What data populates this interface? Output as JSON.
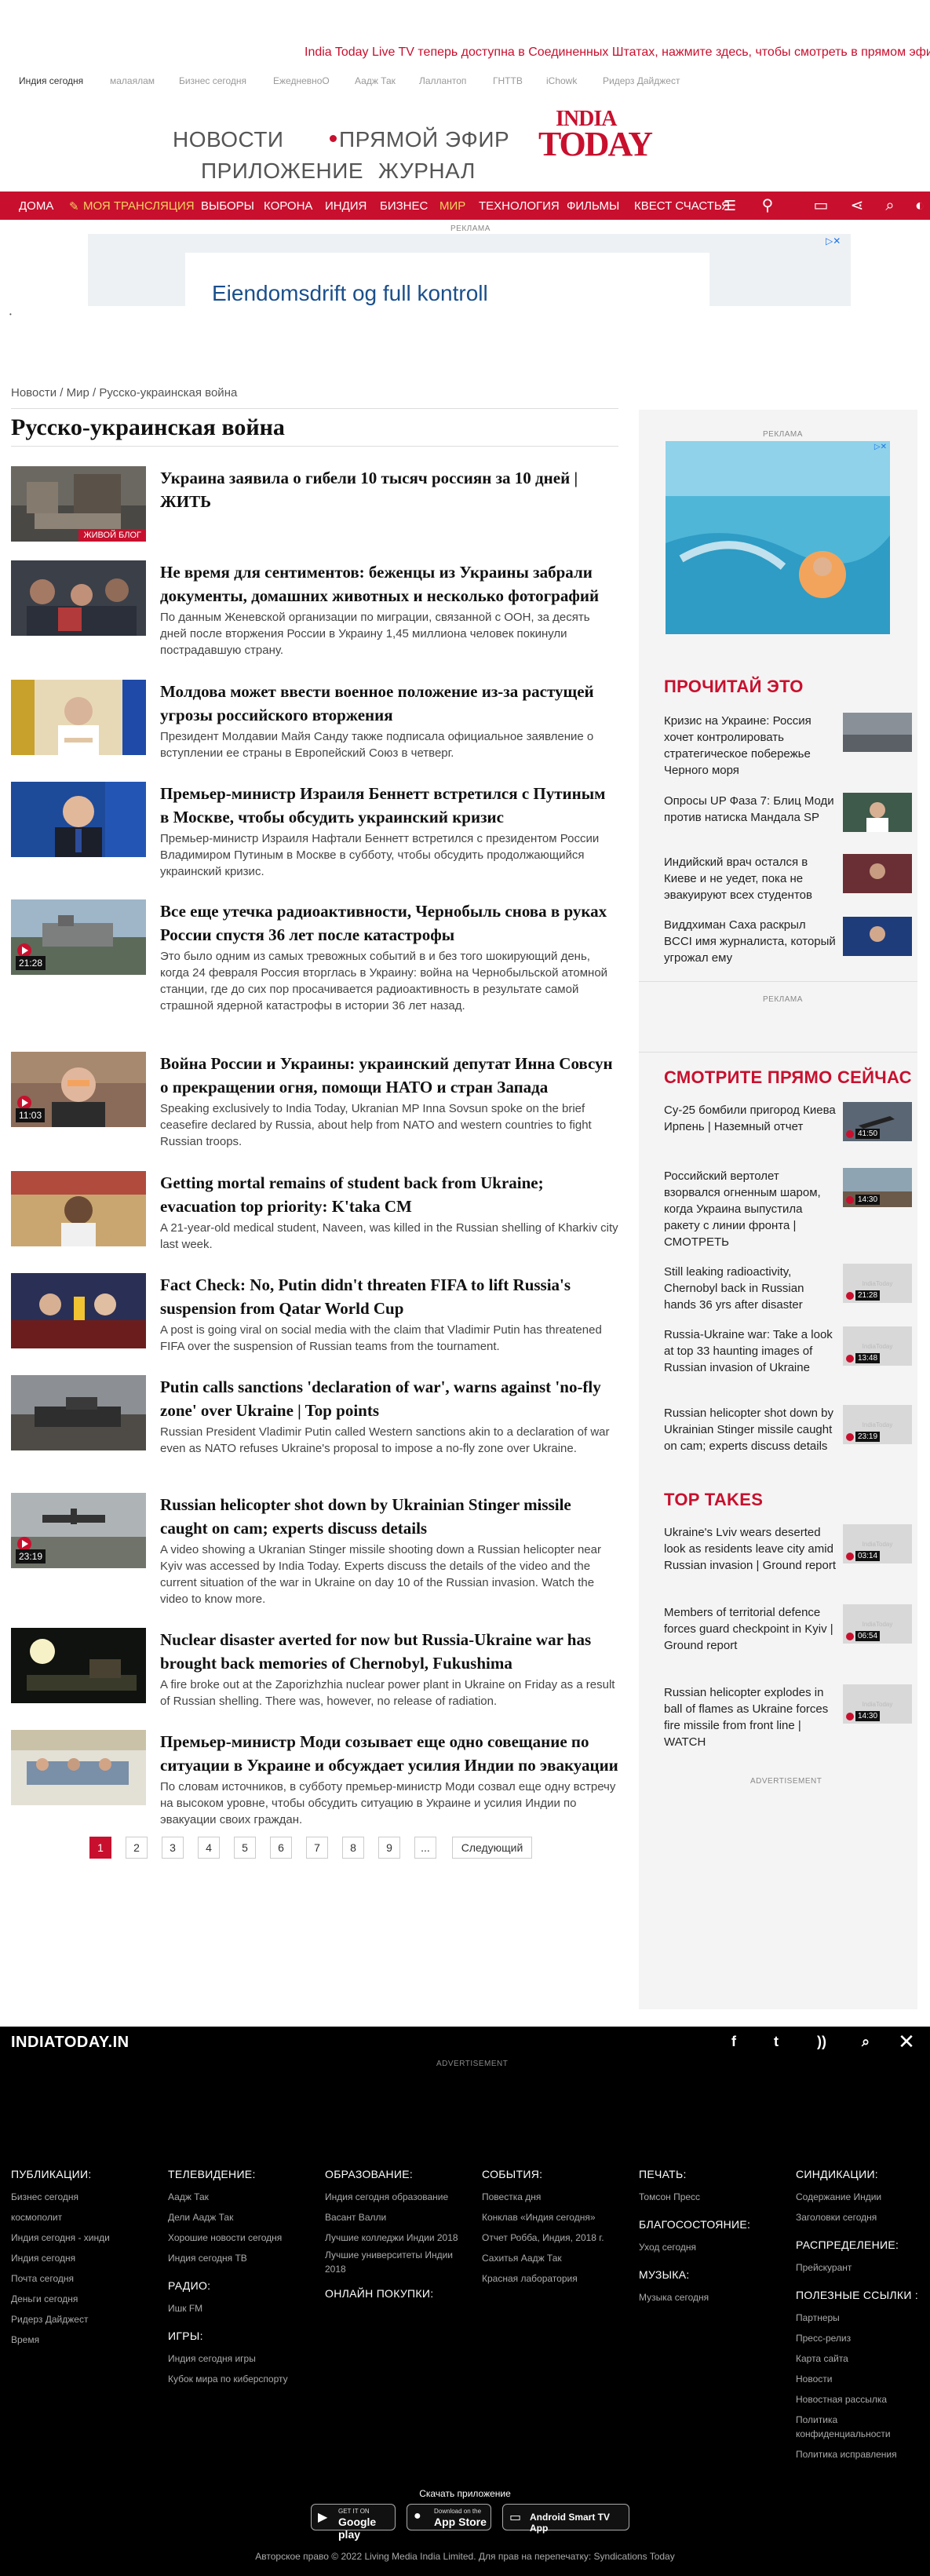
{
  "ticker": "India Today Live TV теперь доступна в Соединенных Штатах, нажмите здесь, чтобы смотреть в прямом эфире",
  "sister_sites": [
    "Индия сегодня",
    "малаялам",
    "Бизнес сегодня",
    "ЕжедневноО",
    "Аадж Так",
    "Лаллантоп",
    "ГНТТВ",
    "iChowk",
    "Ридерз Дайджест"
  ],
  "brand_links": {
    "news": "НОВОСТИ",
    "live": "ПРЯМОЙ ЭФИР",
    "app": "ПРИЛОЖЕНИЕ",
    "magazine": "ЖУРНАЛ"
  },
  "logo": {
    "line1": "INDIA",
    "line2": "TODAY"
  },
  "nav": [
    "ДОМА",
    "МОЯ ТРАНСЛЯЦИЯ",
    "ВЫБОРЫ",
    "КОРОНА",
    "ИНДИЯ",
    "БИЗНЕС",
    "МИР",
    "ТЕХНОЛОГИЯ",
    "ФИЛЬМЫ",
    "КВЕСТ СЧАСТЬЯ"
  ],
  "colors": {
    "brand_red": "#c8102e",
    "footer_bg": "#000000",
    "rail_bg": "#f4f4f4"
  },
  "ad": {
    "label": "РЕКЛАМА",
    "text": "Eiendomsdrift og full kontroll"
  },
  "breadcrumb": {
    "home": "Новости",
    "sep": "/",
    "section": "Мир",
    "current": "Русско-украинская война"
  },
  "page_title": "Русско-украинская война",
  "stories": [
    {
      "title": "Украина заявила о гибели 10 тысяч россиян за 10 дней | ЖИТЬ",
      "desc": "",
      "badge": "ЖИВОЙ БЛОГ",
      "duration": ""
    },
    {
      "title": "Не время для сентиментов: беженцы из Украины забрали документы, домашних животных и несколько фотографий",
      "desc": "По данным Женевской организации по миграции, связанной с ООН, за десять дней после вторжения России в Украину 1,45 миллиона человек покинули пострадавшую страну.",
      "badge": "",
      "duration": ""
    },
    {
      "title": "Молдова может ввести военное положение из-за растущей угрозы российского вторжения",
      "desc": "Президент Молдавии Майя Санду также подписала официальное заявление о вступлении ее страны в Европейский Союз в четверг.",
      "badge": "",
      "duration": ""
    },
    {
      "title": "Премьер-министр Израиля Беннетт встретился с Путиным в Москве, чтобы обсудить украинский кризис",
      "desc": "Премьер-министр Израиля Нафтали Беннетт встретился с президентом России Владимиром Путиным в Москве в субботу, чтобы обсудить продолжающийся украинский кризис.",
      "badge": "",
      "duration": ""
    },
    {
      "title": "Все еще утечка радиоактивности, Чернобыль снова в руках России спустя 36 лет после катастрофы",
      "desc": "Это было одним из самых тревожных событий в и без того шокирующий день, когда 24 февраля Россия вторглась в Украину: война на Чернобыльской атомной станции, где до сих пор просачивается радиоактивность в результате самой страшной ядерной катастрофы в истории 36 лет назад.",
      "badge": "",
      "duration": "21:28"
    },
    {
      "title": "Война России и Украины: украинский депутат Инна Совсун о прекращении огня, помощи НАТО и стран Запада",
      "desc": "Speaking exclusively to India Today, Ukranian MP Inna Sovsun spoke on the brief ceasefire declared by Russia, about help from NATO and western countries to fight Russian troops.",
      "badge": "",
      "duration": "11:03"
    },
    {
      "title": "Getting mortal remains of student back from Ukraine; evacuation top priority: K'taka CM",
      "desc": "A 21-year-old medical student, Naveen, was killed in the Russian shelling of Kharkiv city last week.",
      "badge": "",
      "duration": ""
    },
    {
      "title": "Fact Check: No, Putin didn't threaten FIFA to lift Russia's suspension from Qatar World Cup",
      "desc": "A post is going viral on social media with the claim that Vladimir Putin has threatened FIFA over the suspension of Russian teams from the tournament.",
      "badge": "",
      "duration": ""
    },
    {
      "title": "Putin calls sanctions 'declaration of war', warns against 'no-fly zone' over Ukraine | Top points",
      "desc": "Russian President Vladimir Putin called Western sanctions akin to a declaration of war even as NATO refuses Ukraine's proposal to impose a no-fly zone over Ukraine.",
      "badge": "",
      "duration": ""
    },
    {
      "title": "Russian helicopter shot down by Ukrainian Stinger missile caught on cam; experts discuss details",
      "desc": "A video showing a Ukranian Stinger missile shooting down a Russian helicopter near Kyiv was accessed by India Today. Experts discuss the details of the video and the current situation of the war in Ukraine on day 10 of the Russian invasion. Watch the video to know more.",
      "badge": "",
      "duration": "23:19"
    },
    {
      "title": "Nuclear disaster averted for now but Russia-Ukraine war has brought back memories of Chernobyl, Fukushima",
      "desc": "A fire broke out at the Zaporizhzhia nuclear power plant in Ukraine on Friday as a result of Russian shelling. There was, however, no release of radiation.",
      "badge": "",
      "duration": ""
    },
    {
      "title": "Премьер-министр Моди созывает еще одно совещание по ситуации в Украине и обсуждает усилия Индии по эвакуации",
      "desc": "По словам источников, в субботу премьер-министр Моди созвал еще одну встречу на высоком уровне, чтобы обсудить ситуацию в Украине и усилия Индии по эвакуации своих граждан.",
      "badge": "",
      "duration": ""
    }
  ],
  "pagination": {
    "pages": [
      "1",
      "2",
      "3",
      "4",
      "5",
      "6",
      "7",
      "8",
      "9",
      "..."
    ],
    "next": "Следующий",
    "current": "1"
  },
  "sidebar": {
    "ad_label": "РЕКЛАМА",
    "read_title": "ПРОЧИТАЙ ЭТО",
    "read_items": [
      {
        "text": "Кризис на Украине: Россия хочет контролировать стратегическое побережье Черного моря"
      },
      {
        "text": "Опросы UP Фаза 7: Блиц Моди против натиска Мандала SP"
      },
      {
        "text": "Индийский врач остался в Киеве и не уедет, пока не эвакуируют всех студентов"
      },
      {
        "text": "Виддхиман Саха раскрыл BCCI имя журналиста, который угрожал ему"
      }
    ],
    "ad_label2": "РЕКЛАМА",
    "watch_title": "СМОТРИТЕ ПРЯМО СЕЙЧАС",
    "watch_items": [
      {
        "text": "Су-25 бомбили пригород Киева Ирпень | Наземный отчет",
        "duration": "41:50"
      },
      {
        "text": "Российский вертолет взорвался огненным шаром, когда Украина выпустила ракету с линии фронта | СМОТРЕТЬ",
        "duration": "14:30"
      },
      {
        "text": "Still leaking radioactivity, Chernobyl back in Russian hands 36 yrs after disaster",
        "duration": "21:28"
      },
      {
        "text": "Russia-Ukraine war: Take a look at top 33 haunting images of Russian invasion of Ukraine",
        "duration": "13:48"
      },
      {
        "text": "Russian helicopter shot down by Ukrainian Stinger missile caught on cam; experts discuss details",
        "duration": "23:19"
      }
    ],
    "top_title": "TOP TAKES",
    "top_items": [
      {
        "text": "Ukraine's Lviv wears deserted look as residents leave city amid Russian invasion | Ground report",
        "duration": "03:14"
      },
      {
        "text": "Members of territorial defence forces guard checkpoint in Kyiv | Ground report",
        "duration": "06:54"
      },
      {
        "text": "Russian helicopter explodes in ball of flames as Ukraine forces fire missile from front line | WATCH",
        "duration": "14:30"
      }
    ],
    "ad_label3": "ADVERTISEMENT"
  },
  "footer": {
    "logo": "INDIATODAY.IN",
    "ad_label": "ADVERTISEMENT",
    "columns": [
      {
        "heading": "ПУБЛИКАЦИИ:",
        "links": [
          "Бизнес сегодня",
          "космополит",
          "Индия сегодня - хинди",
          "Индия сегодня",
          "Почта сегодня",
          "Деньги сегодня",
          "Ридерз Дайджест",
          "Время"
        ]
      },
      {
        "heading": "ТЕЛЕВИДЕНИЕ:",
        "links": [
          "Аадж Так",
          "Дели Аадж Так",
          "Хорошие новости сегодня",
          "Индия сегодня ТВ"
        ],
        "heading2": "РАДИО:",
        "links2": [
          "Ишк FM"
        ],
        "heading3": "ИГРЫ:",
        "links3": [
          "Индия сегодня игры",
          "Кубок мира по киберспорту"
        ]
      },
      {
        "heading": "ОБРАЗОВАНИЕ:",
        "links": [
          "Индия сегодня образование",
          "Васант Валли",
          "Лучшие колледжи Индии 2018",
          "Лучшие университеты Индии 2018"
        ],
        "heading2": "ОНЛАЙН ПОКУПКИ:"
      },
      {
        "heading": "СОБЫТИЯ:",
        "links": [
          "Повестка дня",
          "Конклав «Индия сегодня»",
          "Отчет Робба, Индия, 2018 г.",
          "Сахитья Аадж Так",
          "Красная лаборатория"
        ]
      },
      {
        "heading": "ПЕЧАТЬ:",
        "links": [
          "Томсон Пресс"
        ],
        "heading2": "БЛАГОСОСТОЯНИЕ:",
        "links2": [
          "Уход сегодня"
        ],
        "heading3": "МУЗЫКА:",
        "links3": [
          "Музыка сегодня"
        ]
      },
      {
        "heading": "СИНДИКАЦИИ:",
        "links": [
          "Содержание Индии",
          "Заголовки сегодня"
        ],
        "heading2": "РАСПРЕДЕЛЕНИЕ:",
        "links2": [
          "Прейскурант"
        ],
        "heading3": "ПОЛЕЗНЫЕ ССЫЛКИ :",
        "links3": [
          "Партнеры",
          "Пресс-релиз",
          "Карта сайта",
          "Новости",
          "Новостная рассылка",
          "Политика конфиденциальности",
          "Политика исправления"
        ]
      }
    ],
    "download": "Скачать приложение",
    "stores": [
      {
        "small": "GET IT ON",
        "big": "Google play"
      },
      {
        "small": "Download on the",
        "big": "App Store"
      },
      {
        "small": "",
        "big": "Android Smart TV App"
      }
    ],
    "copyright": "Авторское право © 2022 Living Media India Limited. Для прав на перепечатку: Syndications Today"
  }
}
